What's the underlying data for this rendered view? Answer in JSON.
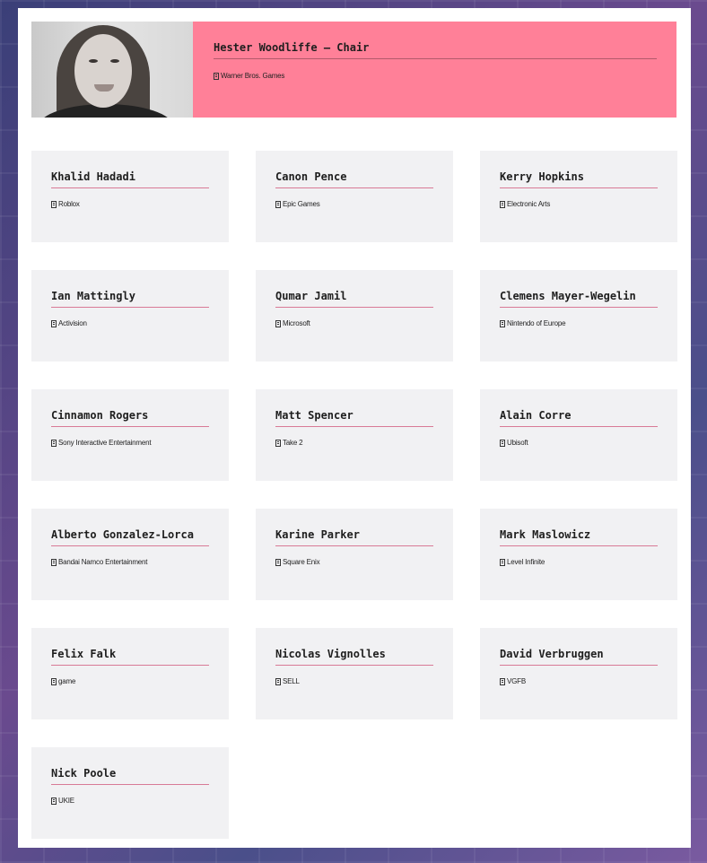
{
  "chair": {
    "name": "Hester Woodliffe – Chair",
    "company": "Warner Bros. Games",
    "photo_alt": "Hester Woodliffe"
  },
  "members": [
    {
      "name": "Khalid Hadadi",
      "company": "Roblox"
    },
    {
      "name": "Canon Pence",
      "company": "Epic Games"
    },
    {
      "name": "Kerry Hopkins",
      "company": "Electronic Arts"
    },
    {
      "name": "Ian Mattingly",
      "company": "Activision"
    },
    {
      "name": "Qumar Jamil",
      "company": "Microsoft"
    },
    {
      "name": "Clemens Mayer-Wegelin",
      "company": "Nintendo of Europe"
    },
    {
      "name": "Cinnamon Rogers",
      "company": "Sony Interactive Entertainment"
    },
    {
      "name": "Matt Spencer",
      "company": "Take 2"
    },
    {
      "name": "Alain Corre",
      "company": "Ubisoft"
    },
    {
      "name": "Alberto Gonzalez-Lorca",
      "company": "Bandai Namco Entertainment"
    },
    {
      "name": "Karine Parker",
      "company": "Square Enix"
    },
    {
      "name": "Mark Maslowicz",
      "company": "Level Infinite"
    },
    {
      "name": "Felix Falk",
      "company": "game"
    },
    {
      "name": "Nicolas Vignolles",
      "company": "SELL"
    },
    {
      "name": "David Verbruggen",
      "company": "VGFB"
    },
    {
      "name": "Nick Poole",
      "company": "UKIE"
    }
  ],
  "colors": {
    "chair_bg": "#ff8098",
    "card_bg": "#f1f1f3",
    "accent_line": "#d87a96"
  }
}
